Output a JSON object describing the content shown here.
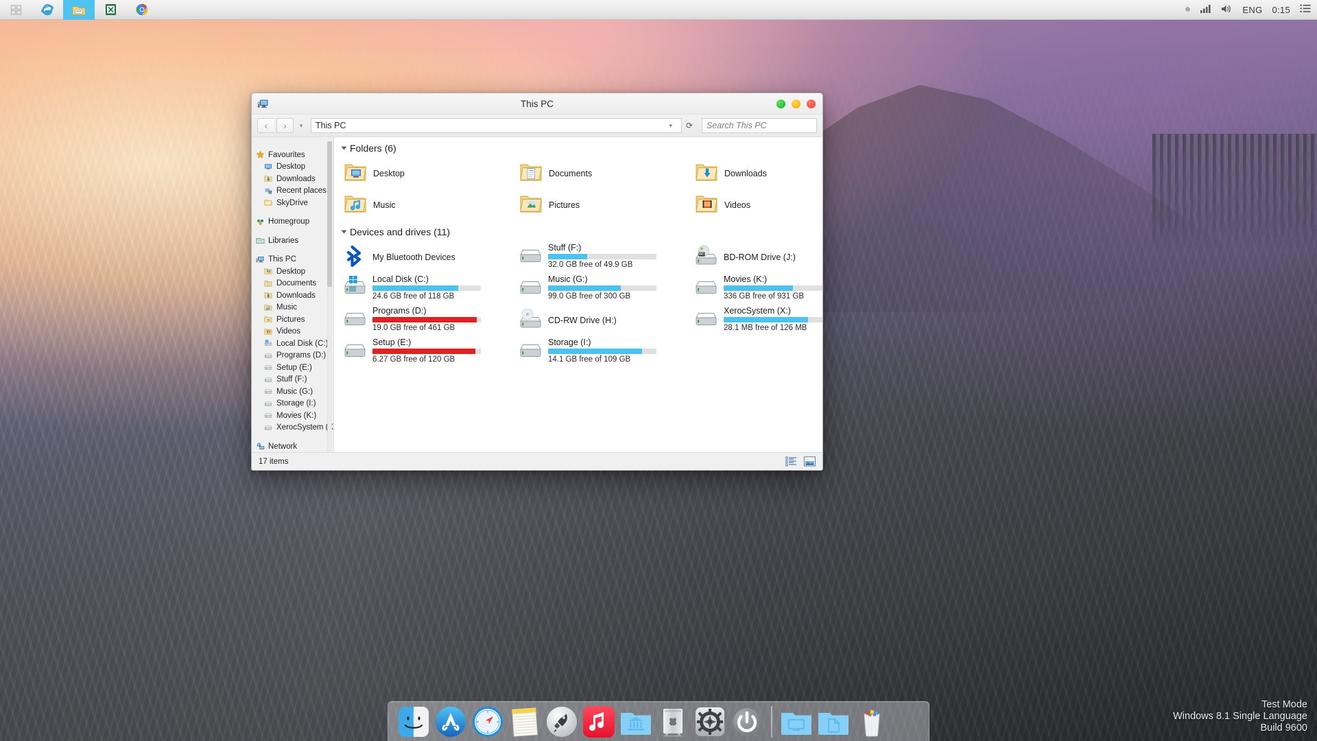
{
  "taskbar": {
    "items": [
      {
        "name": "windows-start",
        "label": "Start"
      },
      {
        "name": "internet-explorer",
        "label": "Internet Explorer"
      },
      {
        "name": "file-explorer",
        "label": "File Explorer"
      },
      {
        "name": "excel",
        "label": "Microsoft Excel"
      },
      {
        "name": "google-chrome",
        "label": "Google Chrome"
      }
    ],
    "tray": {
      "language": "ENG",
      "clock": "0:15"
    }
  },
  "window": {
    "title": "This PC",
    "nav": {
      "back": "‹",
      "forward": "›",
      "recent_caret": "▾",
      "address": "This PC",
      "address_caret": "▾",
      "refresh": "⟳"
    },
    "search": {
      "placeholder": "Search This PC"
    },
    "buttons": {
      "minimize": "green",
      "maximize": "yellow",
      "close": "red"
    },
    "status": {
      "items": "17 items"
    },
    "view_buttons": [
      {
        "name": "details-view-button",
        "label": "Details view"
      },
      {
        "name": "large-icons-view-button",
        "label": "Large icons view"
      }
    ]
  },
  "sidebar": {
    "groups": [
      {
        "root": {
          "label": "Favourites",
          "icon": "star-icon"
        },
        "children": [
          {
            "label": "Desktop",
            "icon": "desktop-icon"
          },
          {
            "label": "Downloads",
            "icon": "downloads-icon"
          },
          {
            "label": "Recent places",
            "icon": "recent-places-icon"
          },
          {
            "label": "SkyDrive",
            "icon": "skydrive-folder-icon"
          }
        ]
      },
      {
        "root": {
          "label": "Homegroup",
          "icon": "homegroup-icon"
        },
        "children": []
      },
      {
        "root": {
          "label": "Libraries",
          "icon": "libraries-icon"
        },
        "children": []
      },
      {
        "root": {
          "label": "This PC",
          "icon": "this-pc-icon"
        },
        "children": [
          {
            "label": "Desktop",
            "icon": "folder-desktop-icon"
          },
          {
            "label": "Documents",
            "icon": "folder-documents-icon"
          },
          {
            "label": "Downloads",
            "icon": "folder-downloads-icon"
          },
          {
            "label": "Music",
            "icon": "folder-music-icon"
          },
          {
            "label": "Pictures",
            "icon": "folder-pictures-icon"
          },
          {
            "label": "Videos",
            "icon": "folder-videos-icon"
          },
          {
            "label": "Local Disk (C:)",
            "icon": "windows-drive-icon"
          },
          {
            "label": "Programs (D:)",
            "icon": "drive-icon"
          },
          {
            "label": "Setup (E:)",
            "icon": "drive-icon"
          },
          {
            "label": "Stuff (F:)",
            "icon": "drive-icon"
          },
          {
            "label": "Music (G:)",
            "icon": "drive-icon"
          },
          {
            "label": "Storage (I:)",
            "icon": "drive-icon"
          },
          {
            "label": "Movies (K:)",
            "icon": "drive-icon"
          },
          {
            "label": "XerocSystem (X:)",
            "icon": "drive-icon"
          }
        ]
      },
      {
        "root": {
          "label": "Network",
          "icon": "network-icon"
        },
        "children": []
      }
    ]
  },
  "content": {
    "folders_section": {
      "title": "Folders (6)"
    },
    "folders": [
      {
        "label": "Desktop",
        "icon": "folder-desktop-icon"
      },
      {
        "label": "Documents",
        "icon": "folder-documents-icon"
      },
      {
        "label": "Downloads",
        "icon": "folder-downloads-icon"
      },
      {
        "label": "Music",
        "icon": "folder-music-icon"
      },
      {
        "label": "Pictures",
        "icon": "folder-pictures-icon"
      },
      {
        "label": "Videos",
        "icon": "folder-videos-icon"
      }
    ],
    "drives_section": {
      "title": "Devices and drives (11)"
    },
    "drives": [
      {
        "label": "My Bluetooth Devices",
        "icon": "bluetooth-icon",
        "type": "simple"
      },
      {
        "label": "Local Disk (C:)",
        "icon": "windows-drive-icon",
        "type": "bar",
        "free": "24.6 GB free of 118 GB",
        "percent": 79,
        "color": "#4cc2f1"
      },
      {
        "label": "Programs (D:)",
        "icon": "drive-icon",
        "type": "bar",
        "free": "19.0 GB free of 461 GB",
        "percent": 96,
        "color": "#e02222"
      },
      {
        "label": "Setup (E:)",
        "icon": "drive-icon",
        "type": "bar",
        "free": "6.27 GB free of 120 GB",
        "percent": 95,
        "color": "#e02222"
      },
      {
        "label": "Stuff (F:)",
        "icon": "drive-icon",
        "type": "bar",
        "free": "32.0 GB free of 49.9 GB",
        "percent": 36,
        "color": "#4cc2f1"
      },
      {
        "label": "Music (G:)",
        "icon": "drive-icon",
        "type": "bar",
        "free": "99.0 GB free of 300 GB",
        "percent": 67,
        "color": "#4cc2f1"
      },
      {
        "label": "CD-RW Drive (H:)",
        "icon": "cd-rw-drive-icon",
        "type": "simple"
      },
      {
        "label": "Storage (I:)",
        "icon": "drive-icon",
        "type": "bar",
        "free": "14.1 GB free of 109 GB",
        "percent": 87,
        "color": "#4cc2f1"
      },
      {
        "label": "BD-ROM Drive (J:)",
        "icon": "bd-rom-drive-icon",
        "type": "simple"
      },
      {
        "label": "Movies (K:)",
        "icon": "drive-icon",
        "type": "bar",
        "free": "336 GB free of 931 GB",
        "percent": 64,
        "color": "#4cc2f1"
      },
      {
        "label": "XerocSystem (X:)",
        "icon": "drive-icon",
        "type": "bar",
        "free": "28.1 MB free of 126 MB",
        "percent": 78,
        "color": "#4cc2f1"
      }
    ]
  },
  "dock": {
    "items": [
      {
        "name": "finder",
        "label": "Finder"
      },
      {
        "name": "app-store",
        "label": "App Store"
      },
      {
        "name": "safari",
        "label": "Safari"
      },
      {
        "name": "notes",
        "label": "Notes"
      },
      {
        "name": "launchpad",
        "label": "Launchpad"
      },
      {
        "name": "itunes",
        "label": "iTunes"
      },
      {
        "name": "bank-folder",
        "label": "Bank"
      },
      {
        "name": "mac-pro",
        "label": "Mac Pro"
      },
      {
        "name": "system-preferences",
        "label": "System Preferences"
      },
      {
        "name": "power",
        "label": "Power"
      }
    ],
    "right_items": [
      {
        "name": "desktop-folder",
        "label": "Desktop"
      },
      {
        "name": "documents-folder",
        "label": "Documents"
      },
      {
        "name": "trash",
        "label": "Trash"
      }
    ]
  },
  "watermark": {
    "line1": "Test Mode",
    "line2": "Windows 8.1 Single Language",
    "line3": "Build 9600"
  }
}
